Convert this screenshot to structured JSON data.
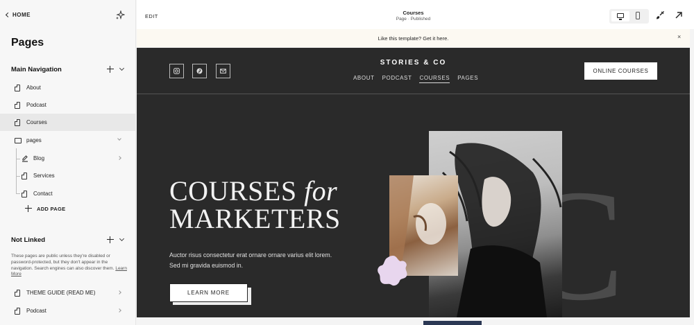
{
  "sidebar": {
    "home_label": "HOME",
    "title": "Pages",
    "main_nav_label": "Main Navigation",
    "items": [
      {
        "label": "About"
      },
      {
        "label": "Podcast"
      },
      {
        "label": "Courses"
      },
      {
        "label": "pages"
      },
      {
        "label": "Blog"
      },
      {
        "label": "Services"
      },
      {
        "label": "Contact"
      }
    ],
    "add_page_label": "ADD PAGE",
    "not_linked_label": "Not Linked",
    "not_linked_desc": "These pages are public unless they're disabled or password-protected, but they don't appear in the navigation. Search engines can also discover them.",
    "learn_more": "Learn More",
    "unlinked_items": [
      {
        "label": "THEME GUIDE (READ ME)"
      },
      {
        "label": "Podcast"
      }
    ]
  },
  "topbar": {
    "edit_label": "EDIT",
    "page_title": "Courses",
    "page_status": "Page · Published"
  },
  "banner": {
    "text": "Like this template? Get it here.",
    "close": "×"
  },
  "site": {
    "brand": "STORIES & CO",
    "nav": [
      "ABOUT",
      "PODCAST",
      "COURSES",
      "PAGES"
    ],
    "cta": "ONLINE COURSES",
    "hero_line1": "COURSES ",
    "hero_line1_italic": "for",
    "hero_line2": "MARKETERS",
    "hero_body": "Auctor risus consectetur erat ornare ornare varius elit lorem. Sed mi gravida euismod in.",
    "hero_button": "LEARN MORE",
    "big_letter": "C"
  },
  "colors": {
    "site_bg": "#2a2a2a",
    "sidebar_bg": "#f7f7f7",
    "banner_bg": "#fcf9f2",
    "flower": "#e8d6ee"
  }
}
